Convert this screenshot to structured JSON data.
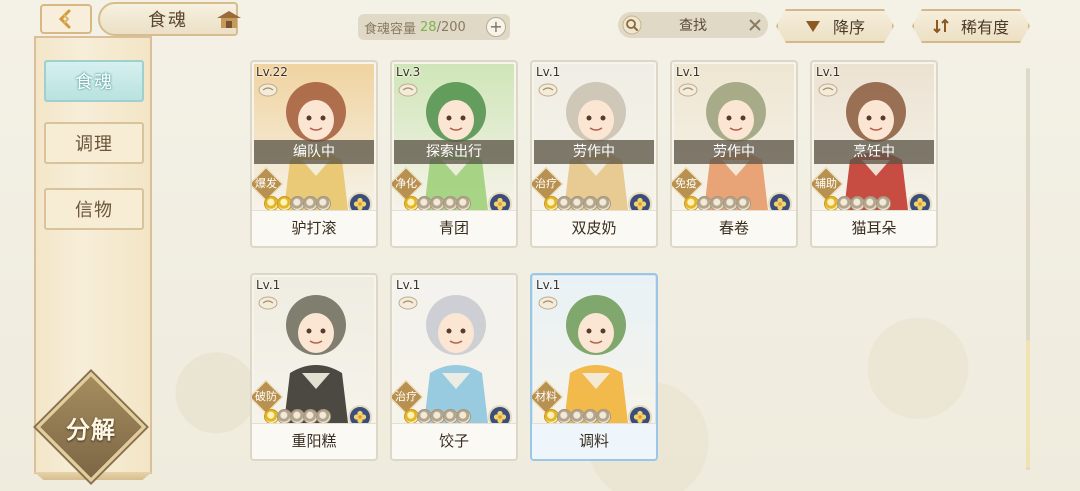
{
  "header": {
    "title": "食魂",
    "capacity_label": "食魂容量",
    "capacity_current": "28",
    "capacity_max": "/200",
    "search_label": "查找",
    "sort_order_label": "降序",
    "sort_field_label": "稀有度"
  },
  "sidebar": {
    "tabs": [
      {
        "label": "食魂",
        "active": true
      },
      {
        "label": "调理",
        "active": false
      },
      {
        "label": "信物",
        "active": false
      }
    ],
    "decompose_label": "分解"
  },
  "cards": [
    {
      "level": "Lv.22",
      "status": "编队中",
      "role": "爆发",
      "name": "驴打滚",
      "stars_on": 2,
      "palette": [
        "#f0d3a0",
        "#a35a3a",
        "#e8c56a"
      ]
    },
    {
      "level": "Lv.3",
      "status": "探索出行",
      "role": "净化",
      "name": "青团",
      "stars_on": 1,
      "palette": [
        "#cfe6b8",
        "#4f8f4a",
        "#9fd07a"
      ]
    },
    {
      "level": "Lv.1",
      "status": "劳作中",
      "role": "治疗",
      "name": "双皮奶",
      "stars_on": 1,
      "palette": [
        "#f0ede5",
        "#c9bfae",
        "#e7c58a"
      ]
    },
    {
      "level": "Lv.1",
      "status": "劳作中",
      "role": "免疫",
      "name": "春卷",
      "stars_on": 1,
      "palette": [
        "#eee6d2",
        "#9aa07a",
        "#e79a6a"
      ]
    },
    {
      "level": "Lv.1",
      "status": "烹饪中",
      "role": "辅助",
      "name": "猫耳朵",
      "stars_on": 1,
      "palette": [
        "#ece2d2",
        "#8a5a3c",
        "#c23a2f"
      ]
    },
    {
      "level": "Lv.1",
      "status": "",
      "role": "破防",
      "name": "重阳糕",
      "stars_on": 1,
      "palette": [
        "#efece2",
        "#6b6a5a",
        "#3a3530"
      ]
    },
    {
      "level": "Lv.1",
      "status": "",
      "role": "治疗",
      "name": "饺子",
      "stars_on": 1,
      "palette": [
        "#f3f2ee",
        "#c7c9cf",
        "#8fc6df"
      ]
    },
    {
      "level": "Lv.1",
      "status": "",
      "role": "材料",
      "name": "调料",
      "stars_on": 1,
      "palette": [
        "#e8f2f6",
        "#6c9a56",
        "#f2b33a"
      ],
      "special": true
    }
  ],
  "colors": {
    "accent_teal": "#b9e2e0",
    "gold": "#d4b887",
    "star_on": "#e3b52a"
  }
}
